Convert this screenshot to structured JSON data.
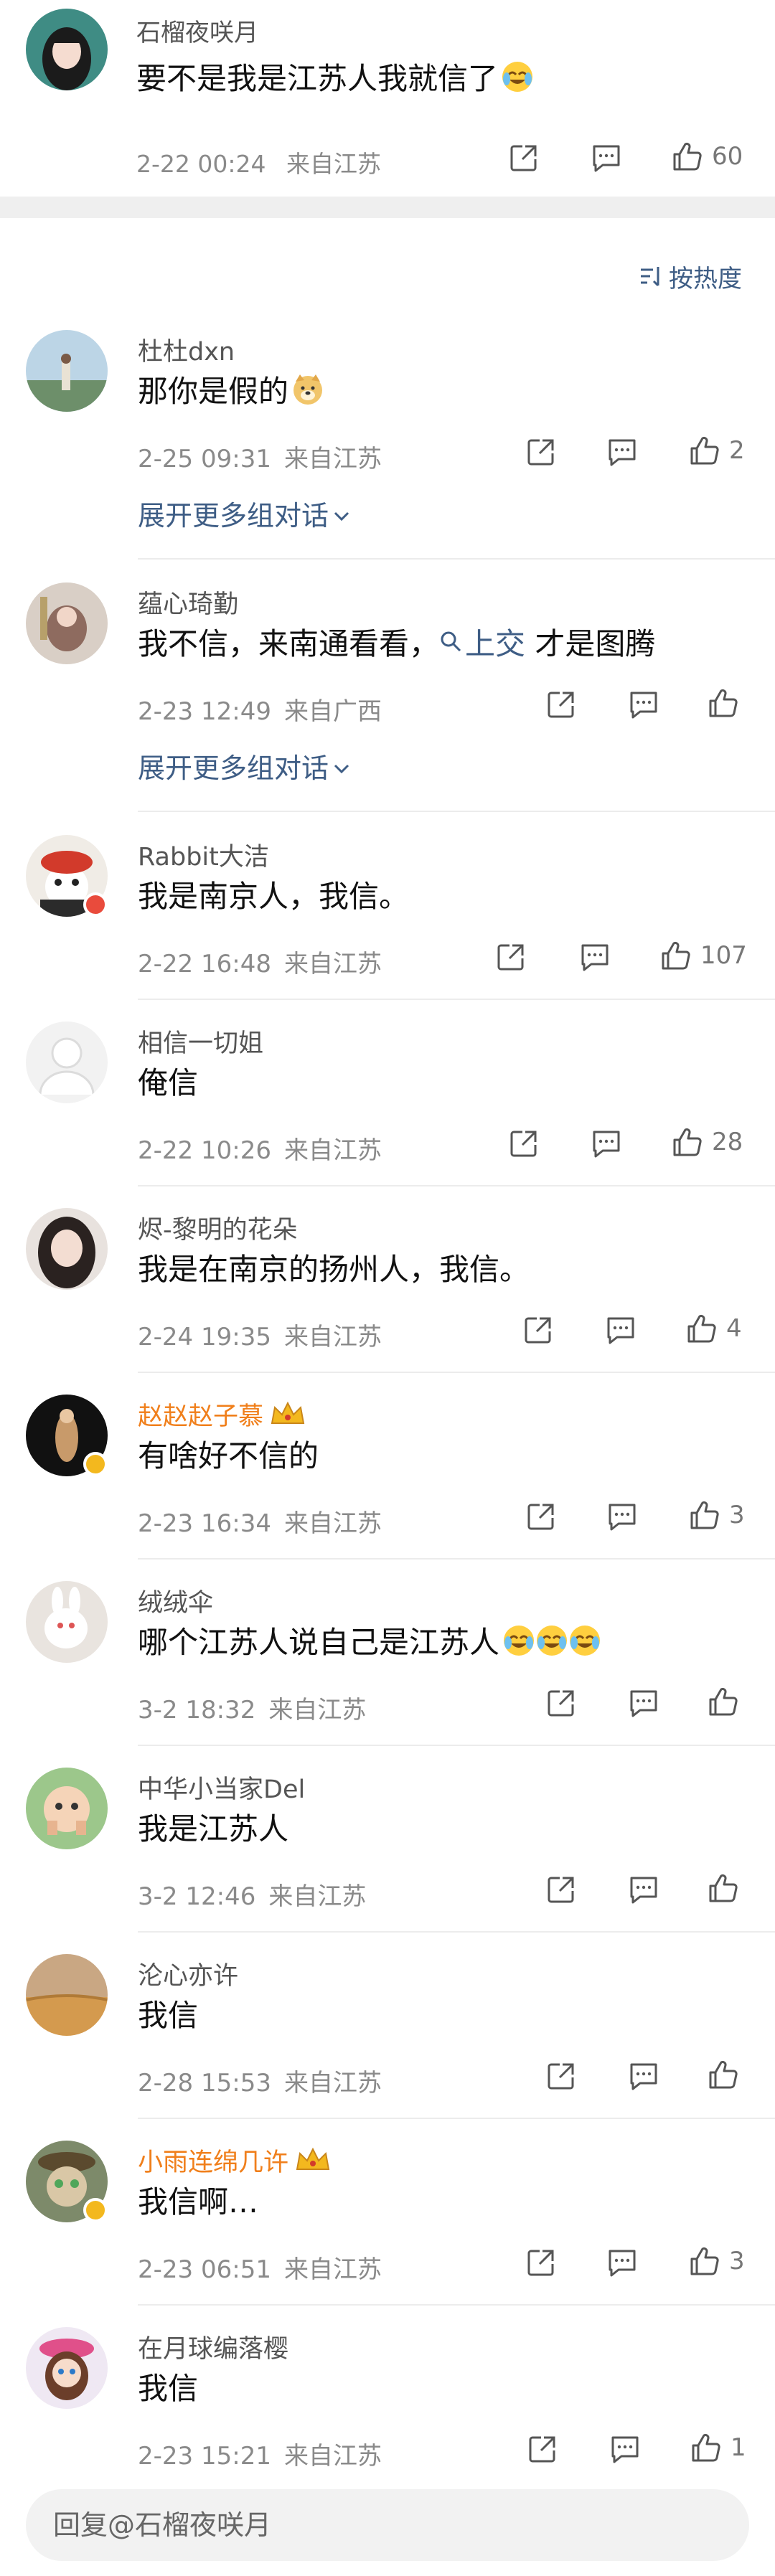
{
  "original": {
    "user": "石榴夜咲月",
    "text": "要不是我是江苏人我就信了",
    "emoji": "laugh-cry-icon",
    "time": "2-22 00:24",
    "location": "来自江苏",
    "likes": "60"
  },
  "sort": {
    "label": "按热度"
  },
  "comments": [
    {
      "user": "杜杜dxn",
      "text": "那你是假的",
      "time": "2-25 09:31",
      "location": "来自江苏",
      "likes": "2",
      "expand": "展开更多组对话"
    },
    {
      "user": "蕴心琦勤",
      "text_prefix": "我不信，来南通看看，",
      "link": "上交",
      "text_suffix": " 才是图腾",
      "time": "2-23 12:49",
      "location": "来自广西",
      "likes": "",
      "expand": "展开更多组对话"
    },
    {
      "user": "Rabbit大洁",
      "text": "我是南京人，我信。",
      "time": "2-22 16:48",
      "location": "来自江苏",
      "likes": "107"
    },
    {
      "user": "相信一切姐",
      "text": "俺信",
      "time": "2-22 10:26",
      "location": "来自江苏",
      "likes": "28"
    },
    {
      "user": "烬-黎明的花朵",
      "text": "我是在南京的扬州人，我信。",
      "time": "2-24 19:35",
      "location": "来自江苏",
      "likes": "4"
    },
    {
      "user": "赵赵赵子慕",
      "text": "有啥好不信的",
      "time": "2-23 16:34",
      "location": "来自江苏",
      "likes": "3"
    },
    {
      "user": "绒绒伞",
      "text": "哪个江苏人说自己是江苏人",
      "time": "3-2 18:32",
      "location": "来自江苏",
      "likes": ""
    },
    {
      "user": "中华小当家Del",
      "text": "我是江苏人",
      "time": "3-2 12:46",
      "location": "来自江苏",
      "likes": ""
    },
    {
      "user": "沦心亦许",
      "text": "我信",
      "time": "2-28 15:53",
      "location": "来自江苏",
      "likes": ""
    },
    {
      "user": "小雨连绵几许",
      "text": "我信啊…",
      "time": "2-23 06:51",
      "location": "来自江苏",
      "likes": "3"
    },
    {
      "user": "在月球编落樱",
      "text": "我信",
      "time": "2-23 15:21",
      "location": "来自江苏",
      "likes": "1"
    }
  ],
  "reply": {
    "placeholder": "回复@石榴夜咲月"
  },
  "colors": {
    "link": "#3e5d85",
    "vip_name": "#f07f1b",
    "meta": "#8a8a8a",
    "divider": "#efefef"
  }
}
